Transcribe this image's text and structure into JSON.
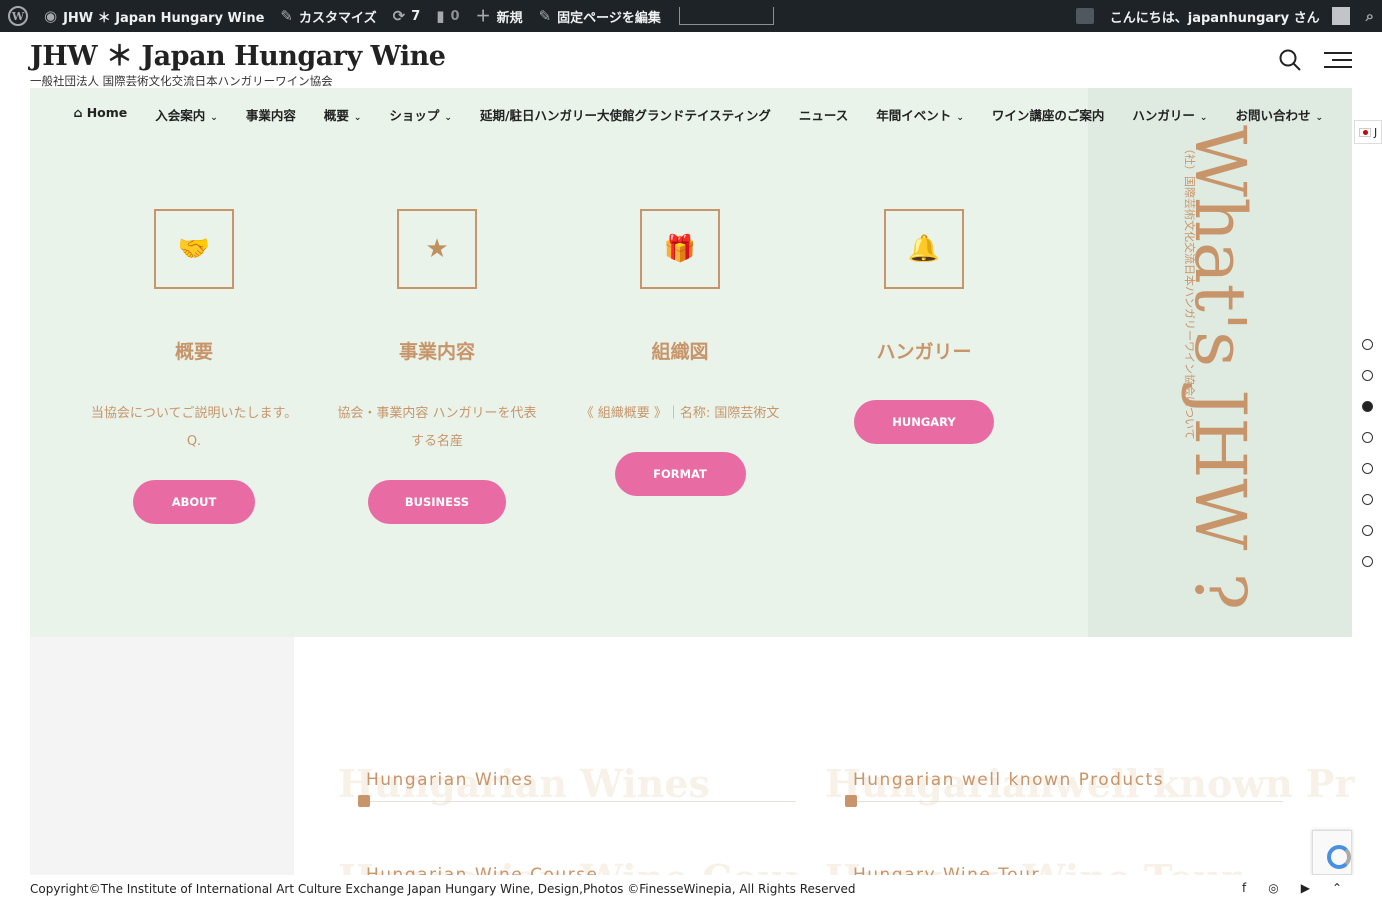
{
  "adminbar": {
    "site_name": "JHW ＊ Japan Hungary Wine",
    "customize": "カスタマイズ",
    "updates_count": "7",
    "comments_count": "0",
    "new_label": "新規",
    "edit_page": "固定ページを編集",
    "greeting": "こんにちは、japanhungary さん"
  },
  "site": {
    "title": "JHW ＊ Japan Hungary Wine",
    "tagline": "一般社団法人 国際芸術文化交流日本ハンガリーワイン協会"
  },
  "nav": {
    "items": [
      {
        "label": "Home",
        "icon": "home-icon"
      },
      {
        "label": "入会案内",
        "caret": true
      },
      {
        "label": "事業内容"
      },
      {
        "label": "概要",
        "caret": true
      },
      {
        "label": "ショップ",
        "caret": true
      },
      {
        "label": "延期/駐日ハンガリー大使館グランドテイスティング"
      },
      {
        "label": "ニュース"
      },
      {
        "label": "年間イベント",
        "caret": true
      },
      {
        "label": "ワイン講座のご案内"
      },
      {
        "label": "ハンガリー",
        "caret": true
      },
      {
        "label": "お問い合わせ",
        "caret": true
      }
    ]
  },
  "features": [
    {
      "icon": "handshake-icon",
      "title": "概要",
      "desc": "当協会についてご説明いたします。 Q.",
      "button": "ABOUT"
    },
    {
      "icon": "star-icon",
      "title": "事業内容",
      "desc": "協会・事業内容 ハンガリーを代表する名産",
      "button": "BUSINESS"
    },
    {
      "icon": "gift-icon",
      "title": "組織図",
      "desc": "《 組織概要 》｜名称: 国際芸術文",
      "button": "FORMAT"
    },
    {
      "icon": "bell-icon",
      "title": "ハンガリー",
      "desc": "",
      "button": "HUNGARY"
    }
  ],
  "side": {
    "heading": "What's JHW ?",
    "sub": "（社）国際芸術文化交流日本ハンガリーワイン協会について"
  },
  "flag": {
    "code": "J"
  },
  "section_dots": {
    "count": 8,
    "active": 3
  },
  "cards": [
    {
      "ghost": "Hungarian Wines",
      "label": "Hungarian Wines"
    },
    {
      "ghost": "Hungarianwell known Pr",
      "label": "Hungarian well known Products"
    },
    {
      "ghost": "Hungarian Wine Course",
      "label": "Hungarian Wine Course"
    },
    {
      "ghost": "Hungary Wine Tour",
      "label": "Hungary Wine Tour"
    }
  ],
  "footer": {
    "copyright": "Copyright©The Institute of International Art Culture Exchange Japan Hungary Wine, Design,Photos ©FinesseWinepia, All Rights Reserved"
  },
  "colors": {
    "accent": "#c8956a",
    "button": "#e96ba4",
    "panel": "#e9f3ea",
    "adminbar": "#1d2327"
  }
}
